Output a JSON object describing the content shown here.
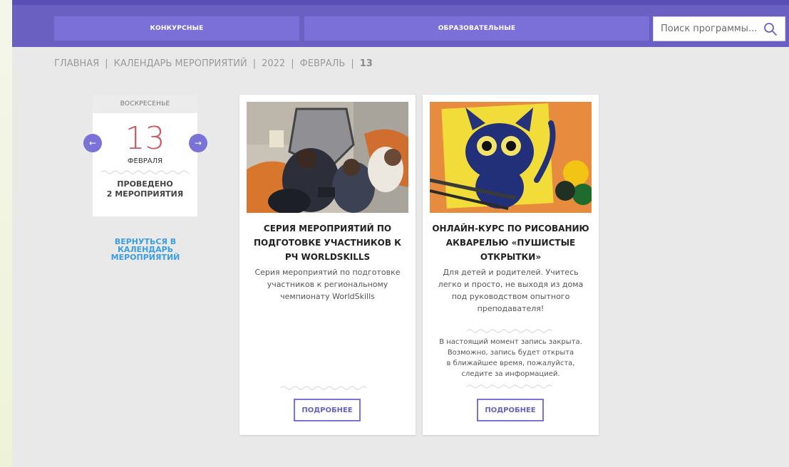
{
  "nav": {
    "competitive_label": "КОНКУРСНЫЕ",
    "educational_label": "ОБРАЗОВАТЕЛЬНЫЕ"
  },
  "search": {
    "placeholder": "Поиск программы..."
  },
  "breadcrumb": {
    "items": [
      "ГЛАВНАЯ",
      "КАЛЕНДАРЬ МЕРОПРИЯТИЙ",
      "2022",
      "ФЕВРАЛЬ"
    ],
    "current": "13",
    "separator": "|"
  },
  "date": {
    "day_of_week": "ВОСКРЕСЕНЬЕ",
    "day": "13",
    "month": "ФЕВРАЛЯ",
    "held_line1": "ПРОВЕДЕНО",
    "held_line2": "2 МЕРОПРИЯТИЯ",
    "prev_icon": "←",
    "next_icon": "→"
  },
  "back_link": {
    "line1": "ВЕРНУТЬСЯ В КАЛЕНДАРЬ",
    "line2": "МЕРОПРИЯТИЙ"
  },
  "events": [
    {
      "title_line1": "СЕРИЯ МЕРОПРИЯТИЙ ПО",
      "title_line2": "ПОДГОТОВКЕ УЧАСТНИКОВ К",
      "title_line3": "РЧ WORLDSKILLS",
      "desc_line1": "Серия мероприятий по подготовке",
      "desc_line2": "участников к региональному",
      "desc_line3": "чемпионату WorldSkills",
      "more_label": "ПОДРОБНЕЕ"
    },
    {
      "title_line1": "ОНЛАЙН-КУРС ПО РИСОВАНИЮ",
      "title_line2": "АКВАРЕЛЬЮ «ПУШИСТЫЕ",
      "title_line3": "ОТКРЫТКИ»",
      "desc_line1": "Для детей и родителей. Учитесь",
      "desc_line2": "легко и просто, не выходя из дома",
      "desc_line3": "под руководством опытного",
      "desc_line4": "преподавателя!",
      "note_line1": "В настоящий момент запись закрыта.",
      "note_line2": "Возможно, запись будет открыта",
      "note_line3": "в ближайшее время, пожалуйста,",
      "note_line4": "следите за информацией.",
      "more_label": "ПОДРОБНЕЕ"
    }
  ],
  "colors": {
    "topbar": "#6a60c2",
    "nav_button": "#7b70d8",
    "day_number": "#c9575d",
    "link": "#3a9ee0",
    "accent": "#7a72d6"
  }
}
